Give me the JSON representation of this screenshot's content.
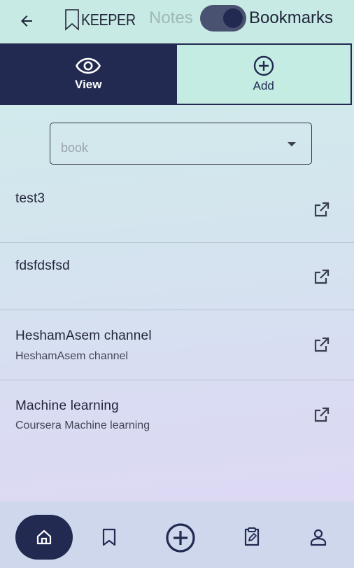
{
  "appbar": {
    "brand": "KEEPER",
    "mode_left": "Notes",
    "mode_right": "Bookmarks",
    "icons": {
      "back": "arrow-back-icon",
      "brand": "bookmark-outline-icon"
    }
  },
  "tabs": [
    {
      "label": "View",
      "icon": "eye-icon",
      "active": true
    },
    {
      "label": "Add",
      "icon": "plus-circle-icon",
      "active": false
    }
  ],
  "filter": {
    "selected": "book"
  },
  "bookmarks": [
    {
      "title": "test3",
      "subtitle": ""
    },
    {
      "title": "fdsfdsfsd",
      "subtitle": ""
    },
    {
      "title": "HeshamAsem channel",
      "subtitle": "HeshamAsem channel"
    },
    {
      "title": "Machine learning",
      "subtitle": "Coursera Machine learning"
    }
  ],
  "bottom_nav": [
    "home-icon",
    "bookmark-icon",
    "add-circle-icon",
    "clipboard-edit-icon",
    "person-icon"
  ],
  "colors": {
    "primary": "#232a52",
    "appbar": "#c7ebe4",
    "nav": "#cfd7ec"
  }
}
